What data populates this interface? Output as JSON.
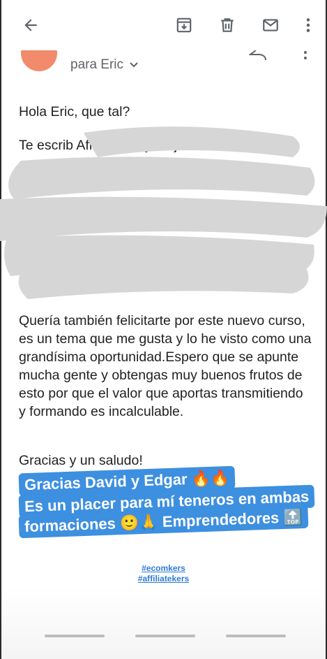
{
  "appbar": {
    "icons": [
      "back-arrow-icon",
      "archive-icon",
      "delete-icon",
      "mail-icon",
      "more-vert-icon"
    ]
  },
  "sender": {
    "to_text": "para Eric"
  },
  "email": {
    "greeting": "Hola Eric, que tal?",
    "redacted_paragraph": "Te escrib          Affilia          i          si          e          y a aj",
    "p3": "Quería también felicitarte por este nuevo curso, es un tema que me gusta y lo he visto como una grandísima oportunidad.Espero que se apunte mucha gente y obtengas muy  buenos frutos de esto por que el valor que aportas transmitiendo y formando es incalculable.",
    "closing": "Gracias y un saludo!"
  },
  "caption": {
    "line1": "Gracias David y Edgar 🔥🔥",
    "line2": "Es un placer para mí teneros en ambas",
    "line3": "formaciones 🙂🙏 Emprendedores 🔝"
  },
  "hashtags": [
    "#ecomkers",
    "#affiliatekers"
  ],
  "colors": {
    "avatar": "#f28b6c",
    "caption_bg": "#3d8fe0",
    "hashtag": "#2f7bd8"
  }
}
